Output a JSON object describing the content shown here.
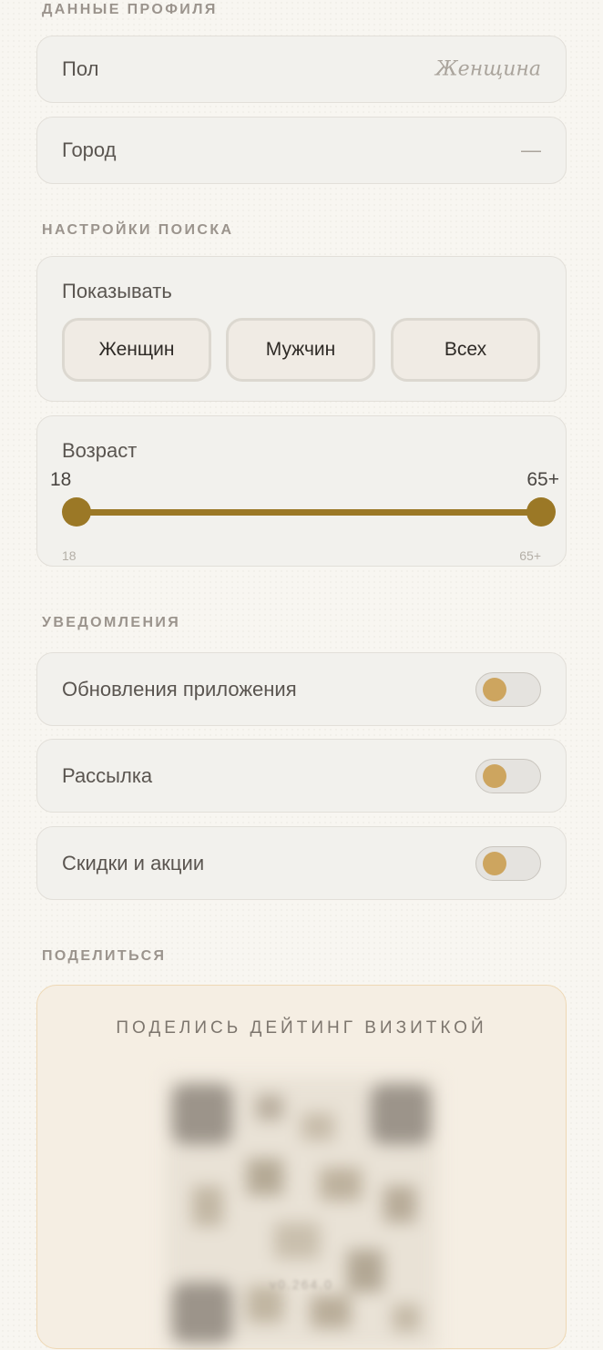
{
  "profile": {
    "section_title": "ДАННЫЕ ПРОФИЛЯ",
    "gender": {
      "label": "Пол",
      "value": "Женщина"
    },
    "city": {
      "label": "Город",
      "value": "—"
    }
  },
  "search": {
    "section_title": "НАСТРОЙКИ ПОИСКА",
    "show": {
      "label": "Показывать",
      "options": [
        "Женщин",
        "Мужчин",
        "Всех"
      ]
    },
    "age": {
      "label": "Возраст",
      "selected_min": "18",
      "selected_max": "65+",
      "range_min": "18",
      "range_max": "65+",
      "min_fraction": 0,
      "max_fraction": 1
    }
  },
  "notifications": {
    "section_title": "УВЕДОМЛЕНИЯ",
    "items": [
      {
        "label": "Обновления приложения",
        "enabled": false
      },
      {
        "label": "Рассылка",
        "enabled": false
      },
      {
        "label": "Скидки и акции",
        "enabled": false
      }
    ]
  },
  "share": {
    "section_title": "ПОДЕЛИТЬСЯ",
    "card_title": "ПОДЕЛИСЬ ДЕЙТИНГ ВИЗИТКОЙ",
    "version": "v0.264.0"
  },
  "colors": {
    "accent": "#9b7826",
    "toggle_knob": "#cda55f",
    "card_bg": "#f2f1ed",
    "page_bg": "#f8f6f1"
  }
}
